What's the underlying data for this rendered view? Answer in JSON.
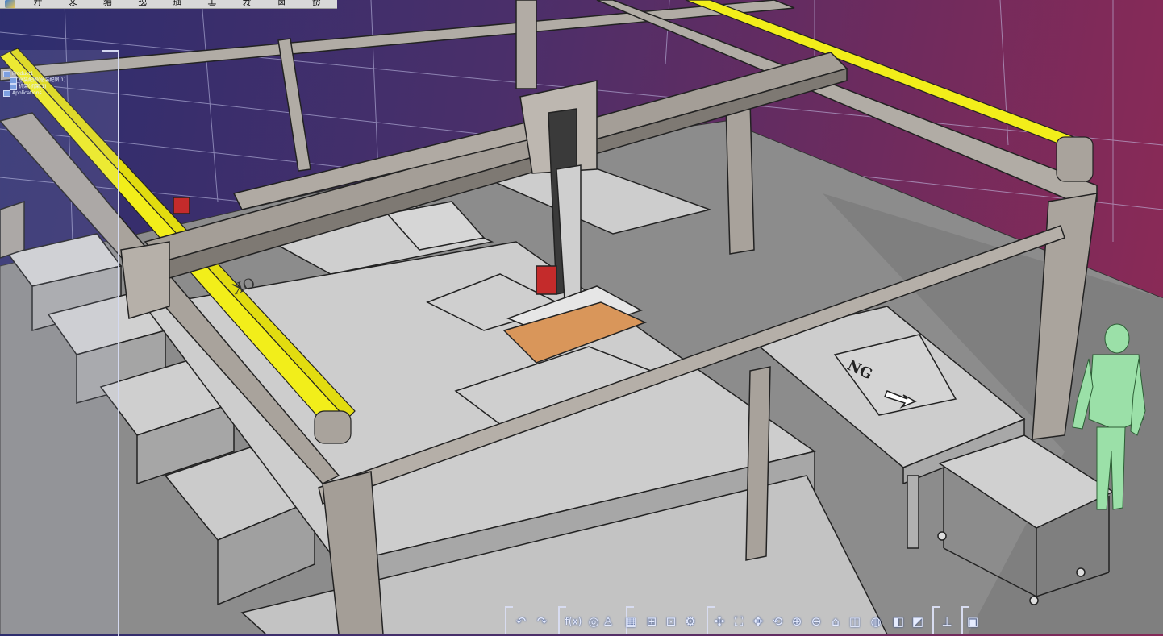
{
  "menu": {
    "items": [
      "开始",
      "文件",
      "编辑",
      "视图",
      "插入",
      "工具",
      "分析",
      "窗口",
      "帮助"
    ]
  },
  "spec_tree": {
    "nodes": [
      {
        "label": "Product1",
        "level": 0
      },
      {
        "label": "总装配图(总装配图.1)",
        "level": 1
      },
      {
        "label": "机架(机架.1)",
        "level": 1
      },
      {
        "label": "Applications",
        "level": 0
      }
    ]
  },
  "scene": {
    "floor_labels": {
      "ok": "OK",
      "ng": "NG"
    },
    "belt_color": "#f2ee1a",
    "frame_color": "#a9a39c",
    "table_color": "#c9c9c9",
    "board_color": "#d9965a",
    "human_color": "#9be0a8"
  },
  "toolbar": {
    "buttons": [
      {
        "icon": "undo-icon",
        "glyph": "↶"
      },
      {
        "icon": "redo-icon",
        "glyph": "↷"
      },
      {
        "icon": "formula-icon",
        "glyph": "f(x)"
      },
      {
        "icon": "lens-icon",
        "glyph": "◎"
      },
      {
        "icon": "user-icon",
        "glyph": "♙"
      },
      {
        "icon": "table-icon",
        "glyph": "▦"
      },
      {
        "icon": "hierarchy-icon",
        "glyph": "⊞"
      },
      {
        "icon": "lock-icon",
        "glyph": "⊡"
      },
      {
        "icon": "tools-icon",
        "glyph": "⚙"
      },
      {
        "icon": "compass-icon",
        "glyph": "✣"
      },
      {
        "icon": "fit-all-icon",
        "glyph": "⛶"
      },
      {
        "icon": "pan-icon",
        "glyph": "✥"
      },
      {
        "icon": "rotate-icon",
        "glyph": "⟲"
      },
      {
        "icon": "zoom-in-icon",
        "glyph": "⊕"
      },
      {
        "icon": "zoom-out-icon",
        "glyph": "⊖"
      },
      {
        "icon": "normal-view-icon",
        "glyph": "⌂"
      },
      {
        "icon": "views-icon",
        "glyph": "◫"
      },
      {
        "icon": "render-style-icon",
        "glyph": "◍"
      },
      {
        "icon": "hide-show-icon",
        "glyph": "◧"
      },
      {
        "icon": "swap-space-icon",
        "glyph": "◩"
      },
      {
        "icon": "measure-icon",
        "glyph": "⊥"
      },
      {
        "icon": "capture-icon",
        "glyph": "▣"
      }
    ]
  }
}
